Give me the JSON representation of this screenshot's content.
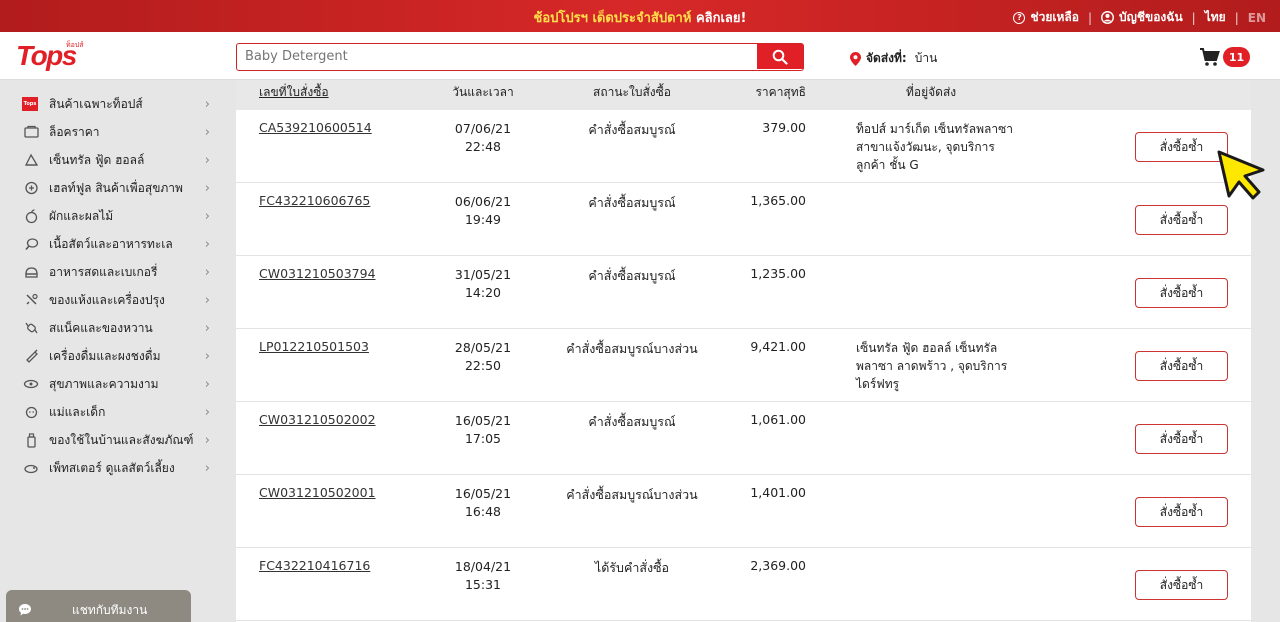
{
  "promo": {
    "text": "ช้อปโปรฯ เด็ดประจำสัปดาห์",
    "link": "คลิกเลย!"
  },
  "top_links": {
    "help": "ช่วยเหลือ",
    "account": "บัญชีของฉัน",
    "lang_th": "ไทย",
    "lang_en": "EN"
  },
  "logo": {
    "text": "Tops",
    "small": "ท็อปส์"
  },
  "search": {
    "value": "",
    "placeholder": "Baby Detergent"
  },
  "delivery": {
    "label": "จัดส่งที่:",
    "value": "บ้าน"
  },
  "cart": {
    "count": "11"
  },
  "sidebar": {
    "items": [
      {
        "label": "สินค้าเฉพาะท็อปส์",
        "icon": "tops-logo-icon"
      },
      {
        "label": "ล็อคราคา",
        "icon": "price-tag-icon"
      },
      {
        "label": "เซ็นทรัล ฟู้ด ฮอลล์",
        "icon": "food-hall-icon"
      },
      {
        "label": "เฮลท์ฟูล สินค้าเพื่อสุขภาพ",
        "icon": "health-icon"
      },
      {
        "label": "ผักและผลไม้",
        "icon": "apple-icon"
      },
      {
        "label": "เนื้อสัตว์และอาหารทะเล",
        "icon": "meat-icon"
      },
      {
        "label": "อาหารสดและเบเกอรี่",
        "icon": "bakery-icon"
      },
      {
        "label": "ของแห้งและเครื่องปรุง",
        "icon": "dry-goods-icon"
      },
      {
        "label": "สแน็คและของหวาน",
        "icon": "candy-icon"
      },
      {
        "label": "เครื่องดื่มและผงชงดื่ม",
        "icon": "drink-icon"
      },
      {
        "label": "สุขภาพและความงาม",
        "icon": "beauty-icon"
      },
      {
        "label": "แม่และเด็ก",
        "icon": "baby-icon"
      },
      {
        "label": "ของใช้ในบ้านและสังฆภัณฑ์",
        "icon": "household-icon"
      },
      {
        "label": "เพ็ทสเตอร์ ดูแลสัตว์เลี้ยง",
        "icon": "pet-icon"
      }
    ]
  },
  "chat": {
    "label": "แชทกับทีมงาน"
  },
  "table": {
    "headers": {
      "order": "เลขที่ใบสั่งซื้อ",
      "datetime": "วันและเวลา",
      "status": "สถานะใบสั่งซื้อ",
      "total": "ราคาสุทธิ",
      "address": "ที่อยู่จัดส่ง"
    },
    "reorder_label": "สั่งซื้อซ้ำ",
    "rows": [
      {
        "order": "CA539210600514",
        "date": "07/06/21",
        "time": "22:48",
        "status": "คำสั่งซื้อสมบูรณ์",
        "total": "379.00",
        "address": [
          "ท็อปส์ มาร์เก็ต เซ็นทรัลพลาซา",
          "สาขาแจ้งวัฒนะ, จุดบริการ",
          "ลูกค้า ชั้น G"
        ],
        "faded": false
      },
      {
        "order": "FC432210606765",
        "date": "06/06/21",
        "time": "19:49",
        "status": "คำสั่งซื้อสมบูรณ์",
        "total": "1,365.00",
        "address": [
          "",
          "",
          ""
        ],
        "faded": true
      },
      {
        "order": "CW031210503794",
        "date": "31/05/21",
        "time": "14:20",
        "status": "คำสั่งซื้อสมบูรณ์",
        "total": "1,235.00",
        "address": [
          "",
          "",
          ""
        ],
        "faded": true
      },
      {
        "order": "LP012210501503",
        "date": "28/05/21",
        "time": "22:50",
        "status": "คำสั่งซื้อสมบูรณ์บางส่วน",
        "total": "9,421.00",
        "address": [
          "เซ็นทรัล ฟู้ด ฮอลล์ เซ็นทรัล",
          "พลาซา ลาดพร้าว , จุดบริการ",
          "ไดร์ฟทรู"
        ],
        "faded": false
      },
      {
        "order": "CW031210502002",
        "date": "16/05/21",
        "time": "17:05",
        "status": "คำสั่งซื้อสมบูรณ์",
        "total": "1,061.00",
        "address": [
          "",
          "",
          ""
        ],
        "faded": true
      },
      {
        "order": "CW031210502001",
        "date": "16/05/21",
        "time": "16:48",
        "status": "คำสั่งซื้อสมบูรณ์บางส่วน",
        "total": "1,401.00",
        "address": [
          "",
          "",
          ""
        ],
        "faded": true
      },
      {
        "order": "FC432210416716",
        "date": "18/04/21",
        "time": "15:31",
        "status": "ได้รับคำสั่งซื้อ",
        "total": "2,369.00",
        "address": [
          "",
          "",
          ""
        ],
        "faded": true
      }
    ]
  },
  "colors": {
    "brand_red": "#e01f26",
    "promo_highlight": "#ffe04a",
    "cursor_yellow": "#ffe800"
  }
}
